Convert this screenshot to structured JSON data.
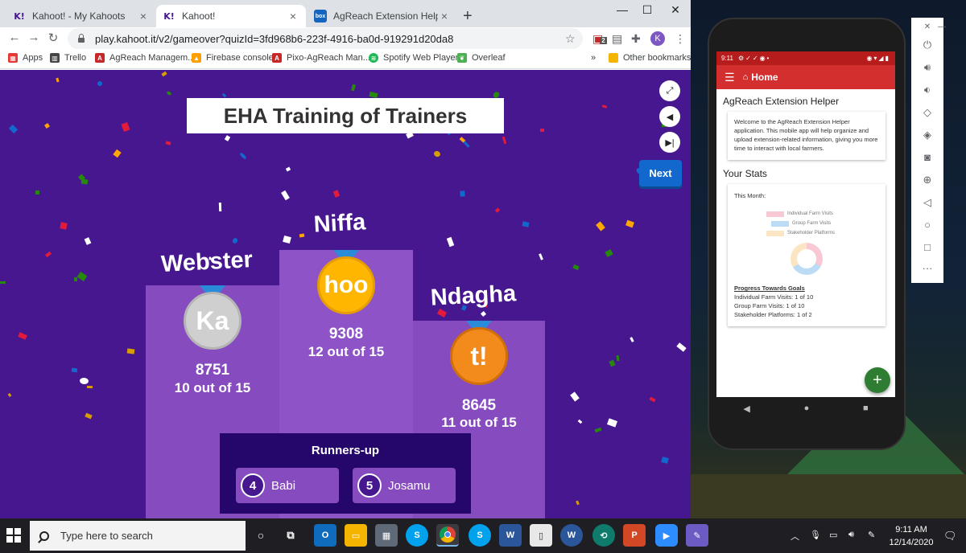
{
  "browser": {
    "tabs": [
      {
        "label": "Kahoot! - My Kahoots",
        "favicon": "K!"
      },
      {
        "label": "Kahoot!",
        "favicon": "K!"
      },
      {
        "label": "AgReach Extension Helper App |",
        "favicon": "box"
      }
    ],
    "url": "play.kahoot.it/v2/gameover?quizId=3fd968b6-223f-4916-ba0d-919291d20da8",
    "profile_initial": "K",
    "extension_badge": "2",
    "bookmarks": [
      {
        "label": "Apps",
        "color": "#e53935"
      },
      {
        "label": "Trello",
        "color": "#444444"
      },
      {
        "label": "AgReach Managem...",
        "color": "#c62828"
      },
      {
        "label": "Firebase console",
        "color": "#ffa000"
      },
      {
        "label": "Pixo-AgReach Man...",
        "color": "#c62828"
      },
      {
        "label": "Spotify Web Player",
        "color": "#1db954"
      },
      {
        "label": "Overleaf",
        "color": "#4caf50"
      }
    ],
    "bookmarks_more": "»",
    "other_bookmarks": "Other bookmarks"
  },
  "game": {
    "quiz_title": "EHA Training of Trainers",
    "next_label": "Next",
    "podium": {
      "first": {
        "name": "Niffa",
        "points": "9308",
        "correct": "12 out of 15",
        "medal": "hoo"
      },
      "second": {
        "name": "Webster",
        "points": "8751",
        "correct": "10 out of 15",
        "medal": "Ka"
      },
      "third": {
        "name": "Ndagha",
        "points": "8645",
        "correct": "11 out of 15",
        "medal": "t!"
      }
    },
    "runners_title": "Runners-up",
    "runners": [
      {
        "rank": "4",
        "name": "Babi"
      },
      {
        "rank": "5",
        "name": "Josamu"
      }
    ],
    "colors": {
      "background": "#46178f",
      "podium": "#864cbf",
      "gold": "#ffb600",
      "silver": "#cfcfcf",
      "bronze": "#f28a1c"
    }
  },
  "phone": {
    "status_time": "9:11",
    "app_title": "Home",
    "heading": "AgReach Extension Helper",
    "welcome_text": "Welcome to the AgReach Extension Helper application. This mobile app will help organize and upload extension-related information, giving you more time to interact with local farmers.",
    "stats_heading": "Your Stats",
    "this_month": "This Month:",
    "legend": [
      {
        "label": "Individual Farm Visits",
        "color": "#f8c9d4"
      },
      {
        "label": "Group Farm Visits",
        "color": "#bcdcf5"
      },
      {
        "label": "Stakeholder Platforms",
        "color": "#fbe5c2"
      }
    ],
    "goals_heading": "Progress Towards Goals",
    "goals": [
      "Individual Farm Visits: 1 of 10",
      "Group Farm Visits: 1 of 10",
      "Stakeholder Platforms: 1 of 2"
    ],
    "fab_label": "+"
  },
  "taskbar": {
    "search_placeholder": "Type here to search",
    "time": "9:11 AM",
    "date": "12/14/2020"
  }
}
